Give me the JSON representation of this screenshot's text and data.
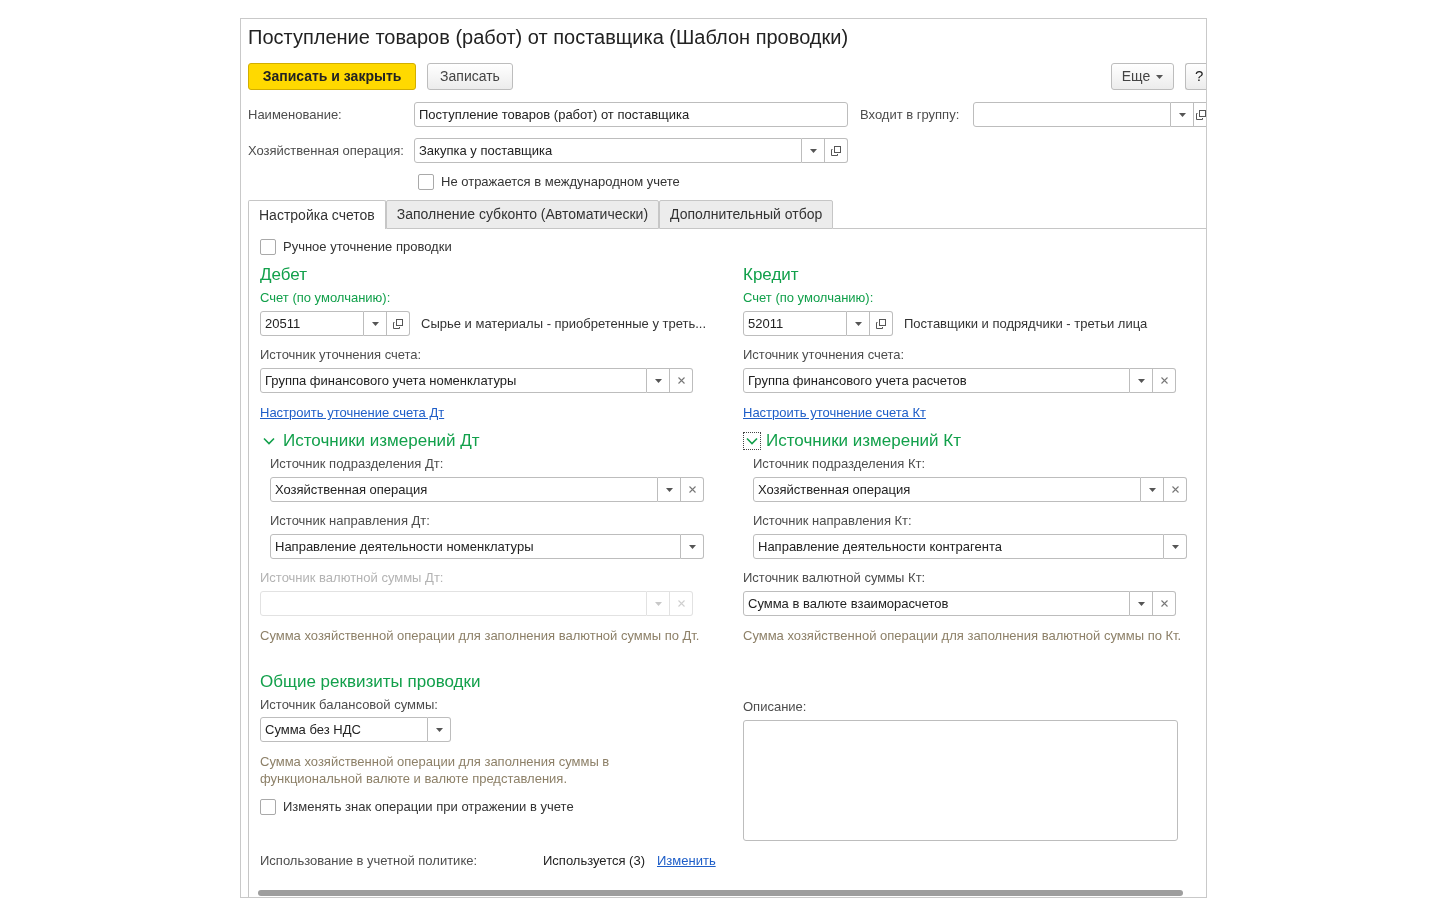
{
  "window": {
    "title": "Поступление товаров (работ) от поставщика (Шаблон проводки)"
  },
  "toolbar": {
    "buttons": [
      {
        "label": "Записать и закрыть",
        "kind": "primary"
      },
      {
        "label": "Записать",
        "kind": "default"
      }
    ],
    "more": "Еще",
    "help": "?"
  },
  "header": {
    "name": {
      "label": "Наименование:",
      "value": "Поступление товаров (работ) от поставщика"
    },
    "group": {
      "label": "Входит в группу:",
      "dropdown": true,
      "open": true
    },
    "operation": {
      "label": "Хозяйственная операция:",
      "value": "Закупка у поставщика",
      "dropdown": true,
      "open": true
    },
    "international": {
      "label": "Не отражается в международном учете",
      "checked": false
    }
  },
  "tabs": [
    {
      "label": "Настройка счетов",
      "selected": true
    },
    {
      "label": "Заполнение субконто (Автоматически)",
      "selected": false
    },
    {
      "label": "Дополнительный отбор",
      "selected": false
    }
  ],
  "manual": {
    "label": "Ручное уточнение проводки",
    "checked": false
  },
  "debit": {
    "heading": "Дебет",
    "account_label": "Счет (по умолчанию):",
    "account": {
      "value": "20511",
      "dropdown": true,
      "open": true
    },
    "account_name": "Сырье и материалы - приобретенные у треть...",
    "refine": {
      "label": "Источник уточнения счета:",
      "value": "Группа финансового учета номенклатуры",
      "dropdown": true,
      "clear": true
    },
    "refine_link": "Настроить уточнение счета Дт",
    "dimensions": {
      "title": "Источники измерений Дт",
      "expanded": true,
      "focused": false,
      "fields": [
        {
          "label": "Источник подразделения Дт:",
          "value": "Хозяйственная операция",
          "dropdown": true,
          "clear": true
        },
        {
          "label": "Источник направления Дт:",
          "value": "Направление деятельности номенклатуры",
          "dropdown": true,
          "clear": false
        }
      ]
    },
    "currency": {
      "label": "Источник валютной суммы Дт:",
      "disabled": true,
      "dropdown": true,
      "clear": true
    },
    "currency_hint": "Сумма хозяйственной операции для заполнения валютной суммы по Дт."
  },
  "credit": {
    "heading": "Кредит",
    "account_label": "Счет (по умолчанию):",
    "account": {
      "value": "52011",
      "dropdown": true,
      "open": true
    },
    "account_name": "Поставщики и подрядчики - третьи лица",
    "refine": {
      "label": "Источник уточнения счета:",
      "value": "Группа финансового учета расчетов",
      "dropdown": true,
      "clear": true
    },
    "refine_link": "Настроить уточнение счета Кт",
    "dimensions": {
      "title": "Источники измерений Кт",
      "expanded": true,
      "focused": true,
      "fields": [
        {
          "label": "Источник подразделения Кт:",
          "value": "Хозяйственная операция",
          "dropdown": true,
          "clear": true
        },
        {
          "label": "Источник направления Кт:",
          "value": "Направление деятельности контрагента",
          "dropdown": true,
          "clear": false
        }
      ]
    },
    "currency": {
      "label": "Источник валютной суммы Кт:",
      "value": "Сумма в валюте взаиморасчетов",
      "disabled": false,
      "dropdown": true,
      "clear": true
    },
    "currency_hint": "Сумма хозяйственной операции для заполнения валютной суммы по Кт."
  },
  "common": {
    "heading": "Общие реквизиты проводки",
    "balance": {
      "label": "Источник балансовой суммы:",
      "value": "Сумма без НДС",
      "dropdown": true
    },
    "hint": "Сумма хозяйственной операции для заполнения суммы в функциональной валюте и валюте представления.",
    "sign": {
      "label": "Изменять знак операции при отражении в учете",
      "checked": false
    }
  },
  "description": {
    "label": "Описание:"
  },
  "policy": {
    "label": "Использование в учетной политике:",
    "status": "Используется (3)",
    "link": "Изменить"
  }
}
